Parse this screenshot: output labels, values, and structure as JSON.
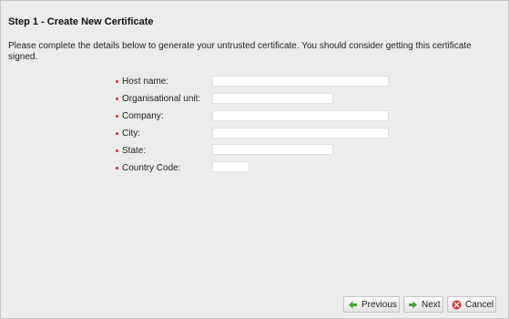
{
  "step": {
    "title": "Step 1 - Create New Certificate",
    "intro": "Please complete the details below to generate your untrusted certificate. You should consider getting this certificate signed."
  },
  "form": {
    "fields": [
      {
        "label": "Host name:",
        "value": ""
      },
      {
        "label": "Organisational unit:",
        "value": ""
      },
      {
        "label": "Company:",
        "value": ""
      },
      {
        "label": "City:",
        "value": ""
      },
      {
        "label": "State:",
        "value": ""
      },
      {
        "label": "Country Code:",
        "value": ""
      }
    ]
  },
  "buttons": {
    "previous": "Previous",
    "next": "Next",
    "cancel": "Cancel"
  },
  "colors": {
    "required_bullet": "#c0392b",
    "arrow_green": "#3fa535",
    "cancel_red": "#d9342b"
  },
  "icons": {
    "previous": "arrow-left-icon",
    "next": "arrow-right-icon",
    "cancel": "cancel-icon",
    "required": "required-bullet-icon"
  }
}
